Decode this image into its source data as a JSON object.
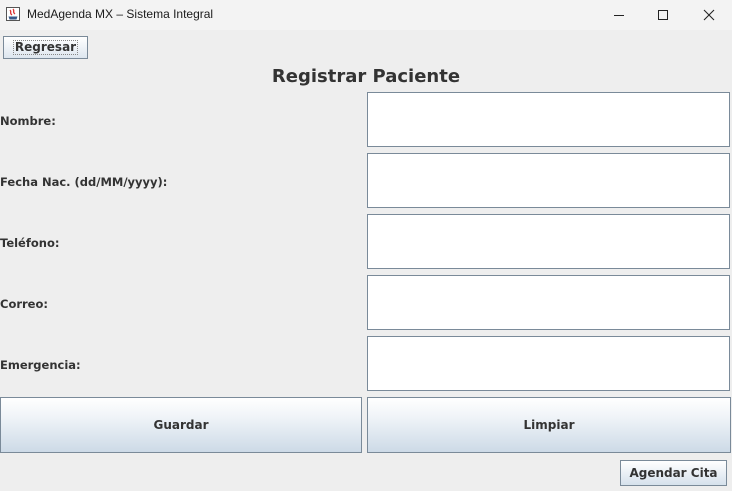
{
  "window": {
    "title": "MedAgenda MX – Sistema Integral",
    "controls": [
      "minimize-icon",
      "maximize-icon",
      "close-icon"
    ]
  },
  "toolbar": {
    "back_label": "Regresar"
  },
  "form": {
    "title": "Registrar Paciente",
    "fields": [
      {
        "label": "Nombre:",
        "value": ""
      },
      {
        "label": "Fecha Nac. (dd/MM/yyyy):",
        "value": ""
      },
      {
        "label": "Teléfono:",
        "value": ""
      },
      {
        "label": "Correo:",
        "value": ""
      },
      {
        "label": "Emergencia:",
        "value": ""
      }
    ]
  },
  "actions": {
    "save_label": "Guardar",
    "clear_label": "Limpiar",
    "schedule_label": "Agendar Cita"
  }
}
